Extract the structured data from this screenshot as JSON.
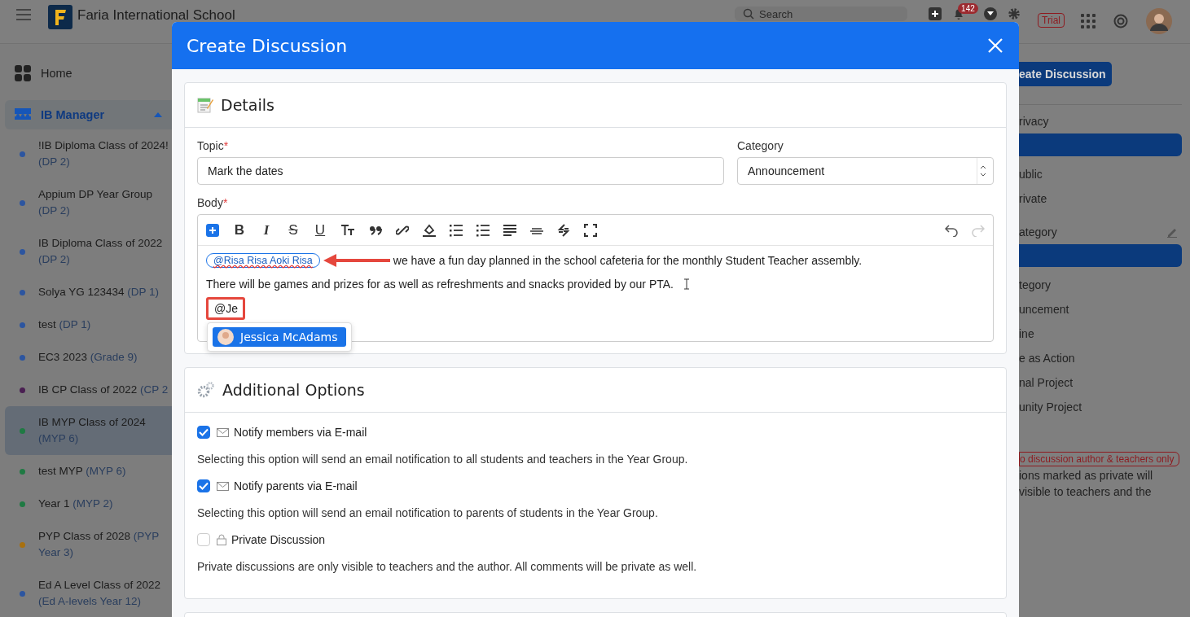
{
  "topbar": {
    "school": "Faria International School",
    "search": {
      "placeholder": "Search"
    },
    "notifications": "142",
    "trial": "Trial"
  },
  "sidebar": {
    "home": "Home",
    "section": {
      "label": "IB Manager",
      "expanded": true
    },
    "items": [
      {
        "title": "!IB Diploma Class of 2024!",
        "level": "(DP 2)",
        "color": "#2c55a0",
        "selected": false
      },
      {
        "title": "Appium DP Year Group",
        "level": "(DP 2)",
        "color": "#2c55a0",
        "selected": false
      },
      {
        "title": "IB Diploma Class of 2022",
        "level": "(DP 2)",
        "color": "#2c55a0",
        "selected": false
      },
      {
        "title": "Solya YG 123434",
        "level": "(DP 1)",
        "color": "#2c55a0",
        "selected": false
      },
      {
        "title": "test",
        "level": "(DP 1)",
        "color": "#2c55a0",
        "selected": false
      },
      {
        "title": "EC3 2023",
        "level": "(Grade 9)",
        "color": "#2c55a0",
        "selected": false
      },
      {
        "title": "IB CP Class of 2022",
        "level": "(CP 2",
        "color": "#4a1f52",
        "selected": false
      },
      {
        "title": "IB MYP Class of 2024",
        "level": "(MYP 6)",
        "color": "#1f7a43",
        "selected": true
      },
      {
        "title": "test MYP",
        "level": "(MYP 6)",
        "color": "#1f7a43",
        "selected": false
      },
      {
        "title": "Year 1",
        "level": "(MYP 2)",
        "color": "#1f7a43",
        "selected": false
      },
      {
        "title": "PYP Class of 2028",
        "level": "(PYP Year 3)",
        "color": "#a8700f",
        "selected": false
      },
      {
        "title": "Ed A Level Class of 2022",
        "level": "(Ed A-levels Year 12)",
        "color": "#2c55a0",
        "selected": false
      }
    ]
  },
  "right_panel": {
    "button": "eate Discussion",
    "privacy_heading": "rivacy",
    "privacy_options": [
      "ublic",
      "rivate"
    ],
    "category_heading": "ategory",
    "category_options": [
      "tegory",
      "uncement",
      "ine",
      "e as Action",
      "nal Project",
      "unity Project"
    ],
    "private_badge": "o discussion author & teachers only",
    "private_note": [
      "ions marked as private will",
      "visible to teachers and the"
    ]
  },
  "modal": {
    "title": "Create Discussion",
    "details": {
      "heading": "Details",
      "topic": {
        "label": "Topic",
        "required_mark": "*",
        "value": "Mark the dates"
      },
      "category": {
        "label": "Category",
        "value": "Announcement"
      },
      "body": {
        "label": "Body",
        "required_mark": "*",
        "toolbar": [
          {
            "kind": "insert"
          },
          {
            "kind": "bold",
            "label": "B"
          },
          {
            "kind": "italic",
            "label": "I"
          },
          {
            "kind": "strike",
            "label": "S"
          },
          {
            "kind": "underline",
            "label": "U"
          },
          {
            "kind": "textsize"
          },
          {
            "kind": "quote"
          },
          {
            "kind": "link"
          },
          {
            "kind": "fill"
          },
          {
            "kind": "bullets"
          },
          {
            "kind": "numbers"
          },
          {
            "kind": "align"
          },
          {
            "kind": "rule"
          },
          {
            "kind": "collapse"
          },
          {
            "kind": "fullscreen"
          }
        ],
        "undo": {
          "disabled": false
        },
        "redo": {
          "disabled": true
        },
        "mention": "@Risa Risa Aoki Risa",
        "line_1": "we have a fun day planned in the school cafeteria for the monthly Student Teacher assembly.",
        "line_2": "There will be games and prizes for as well as refreshments and snacks provided by our PTA.",
        "typing": "@Je",
        "suggestions": [
          {
            "name": "Jessica McAdams",
            "selected": true
          }
        ]
      }
    },
    "options": {
      "heading": "Additional Options",
      "items": [
        {
          "label": "Notify members via E-mail",
          "kind": "mail",
          "checked": true,
          "help": "Selecting this option will send an email notification to all students and teachers in the Year Group."
        },
        {
          "label": "Notify parents via E-mail",
          "kind": "mail",
          "checked": true,
          "help": "Selecting this option will send an email notification to parents of students in the Year Group."
        },
        {
          "label": "Private Discussion",
          "kind": "lock",
          "checked": false,
          "help": "Private discussions are only visible to teachers and the author. All comments will be private as well."
        }
      ]
    }
  }
}
